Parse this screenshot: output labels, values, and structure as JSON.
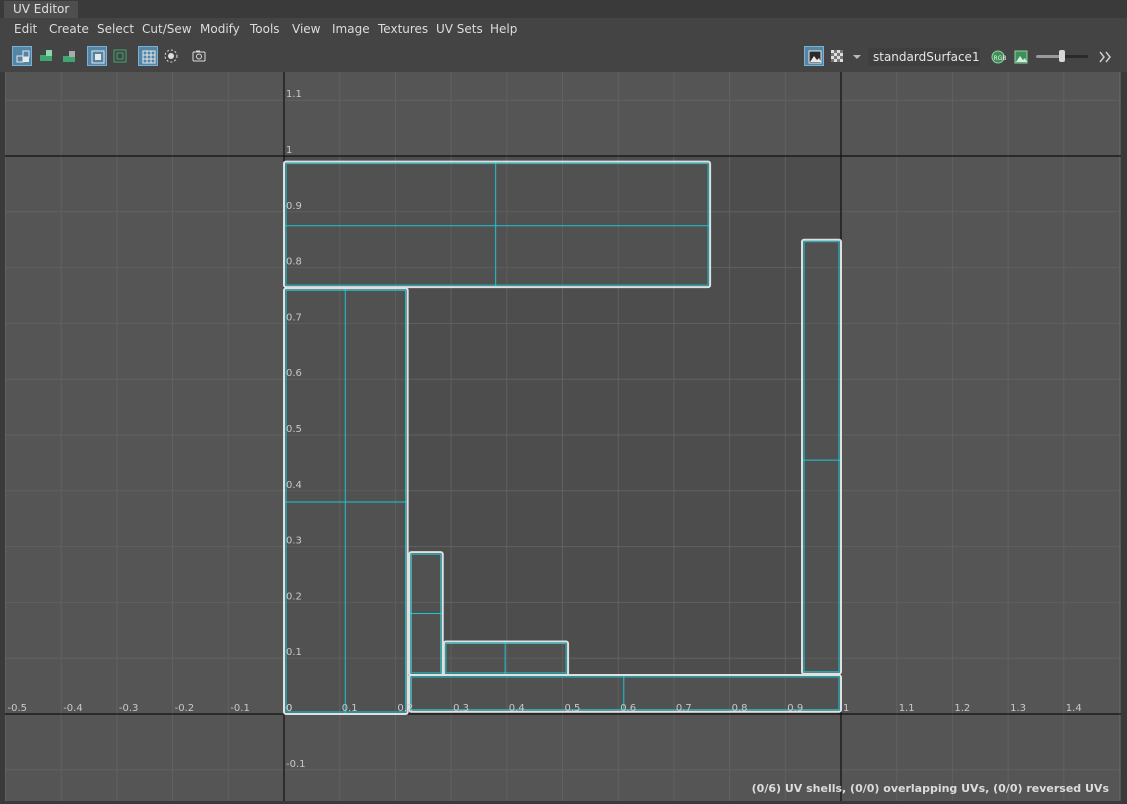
{
  "window": {
    "title": "UV Editor"
  },
  "menu": [
    "Edit",
    "Create",
    "Select",
    "Cut/Sew",
    "Modify",
    "Tools",
    "View",
    "Image",
    "Textures",
    "UV Sets",
    "Help"
  ],
  "toolbar": {
    "left_buttons": [
      {
        "name": "uv-shell-mode-icon",
        "active": true
      },
      {
        "name": "uv-mode-icon",
        "active": false
      },
      {
        "name": "uv-distort-icon",
        "active": false
      },
      {
        "name": "shaded-uv-icon",
        "active": true
      },
      {
        "name": "texture-borders-icon",
        "active": false
      },
      {
        "name": "grid-icon",
        "active": true
      },
      {
        "name": "pixel-snap-icon",
        "active": false
      },
      {
        "name": "snapshot-icon",
        "active": false
      }
    ],
    "material": "standardSurface1",
    "exposure_level": 0.5
  },
  "grid": {
    "x_labels": [
      "-0.5",
      "-0.4",
      "-0.3",
      "-0.2",
      "-0.1",
      "0",
      "0.1",
      "0.2",
      "0.3",
      "0.4",
      "0.5",
      "0.6",
      "0.7",
      "0.8",
      "0.9",
      "1",
      "1.1",
      "1.2",
      "1.3",
      "1.4"
    ],
    "y_labels": [
      "-0.1",
      "0",
      "0.1",
      "0.2",
      "0.3",
      "0.4",
      "0.5",
      "0.6",
      "0.7",
      "0.8",
      "0.9",
      "1",
      "1.1"
    ],
    "colors": {
      "background": "#555555",
      "tile": "#4d4d4d",
      "grid": "#616161",
      "axis": "#111111",
      "shell": "#e0e0e0",
      "edge": "#19c8d2",
      "label": "#c8c8c8"
    }
  },
  "uv_shells": [
    {
      "name": "top-shell",
      "u": [
        0,
        0.765
      ],
      "v": [
        0.765,
        0.99
      ],
      "split_u": [
        0.38
      ],
      "split_v": [
        0.875
      ]
    },
    {
      "name": "left-shell",
      "u": [
        0,
        0.222
      ],
      "v": [
        0,
        0.763
      ],
      "split_u": [
        0.11
      ],
      "split_v": [
        0.38
      ]
    },
    {
      "name": "small-vertical-shell",
      "u": [
        0.225,
        0.285
      ],
      "v": [
        0.07,
        0.29
      ],
      "split_u": [],
      "split_v": [
        0.18
      ]
    },
    {
      "name": "small-horizontal-shell",
      "u": [
        0.287,
        0.51
      ],
      "v": [
        0.07,
        0.13
      ],
      "split_u": [
        0.397
      ],
      "split_v": []
    },
    {
      "name": "bottom-strip-shell",
      "u": [
        0.225,
        1
      ],
      "v": [
        0.004,
        0.07
      ],
      "split_u": [
        0.61
      ],
      "split_v": []
    },
    {
      "name": "right-strip-shell",
      "u": [
        0.93,
        1
      ],
      "v": [
        0.072,
        0.85
      ],
      "split_u": [],
      "split_v": [
        0.455
      ]
    }
  ],
  "status": "(0/6) UV shells, (0/0) overlapping UVs, (0/0) reversed UVs"
}
